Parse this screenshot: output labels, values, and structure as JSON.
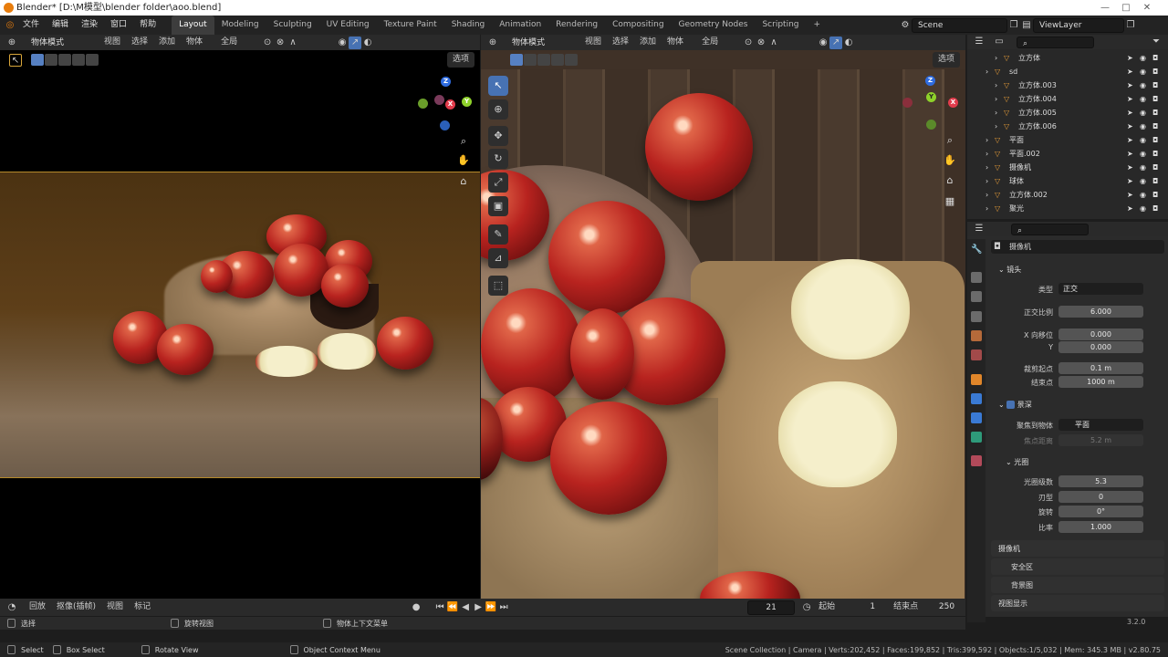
{
  "window": {
    "title": "Blender* [D:\\M模型\\blender folder\\aoo.blend]",
    "minimize": "—",
    "maximize": "□",
    "close": "✕"
  },
  "menu": [
    "文件",
    "编辑",
    "渲染",
    "窗口",
    "帮助"
  ],
  "workspaces": [
    "Layout",
    "Modeling",
    "Sculpting",
    "UV Editing",
    "Texture Paint",
    "Shading",
    "Animation",
    "Rendering",
    "Compositing",
    "Geometry Nodes",
    "Scripting"
  ],
  "active_workspace": "Layout",
  "add_tab": "+",
  "scene": "Scene",
  "view_layer": "ViewLayer",
  "viewport_left": {
    "mode": "物体模式",
    "menus": [
      "视图",
      "选择",
      "添加",
      "物体"
    ],
    "transform": "全局",
    "options": "选项"
  },
  "viewport_right": {
    "mode": "物体模式",
    "menus": [
      "视图",
      "选择",
      "添加",
      "物体"
    ],
    "transform": "全局",
    "options": "选项"
  },
  "gizmo_labels": {
    "x": "X",
    "y": "Y",
    "z": "Z"
  },
  "outliner": {
    "rows": [
      {
        "name": "立方体",
        "indent": 2
      },
      {
        "name": "sd",
        "indent": 1
      },
      {
        "name": "立方体.003",
        "indent": 2
      },
      {
        "name": "立方体.004",
        "indent": 2
      },
      {
        "name": "立方体.005",
        "indent": 2
      },
      {
        "name": "立方体.006",
        "indent": 2
      },
      {
        "name": "平面",
        "indent": 1
      },
      {
        "name": "平面.002",
        "indent": 1
      },
      {
        "name": "摄像机",
        "indent": 1
      },
      {
        "name": "球体",
        "indent": 1
      },
      {
        "name": "立方体.002",
        "indent": 1
      },
      {
        "name": "聚光",
        "indent": 1
      }
    ]
  },
  "properties": {
    "object_name": "摄像机",
    "lens_section": "镜头",
    "type_label": "类型",
    "type_value": "正交",
    "ortho_scale_label": "正交比例",
    "ortho_scale": "6.000",
    "shift_x_label": "X 向移位",
    "shift_x": "0.000",
    "shift_y_label": "Y",
    "shift_y": "0.000",
    "clip_start_label": "裁剪起点",
    "clip_start": "0.1 m",
    "clip_end_label": "结束点",
    "clip_end": "1000 m",
    "dof_section": "景深",
    "focus_object_label": "聚焦到物体",
    "focus_object": "平面",
    "focus_distance_label": "焦点距离",
    "focus_distance": "5.2 m",
    "aperture_section": "光圈",
    "fstop_label": "光圈级数",
    "fstop": "5.3",
    "blades_label": "刃型",
    "blades": "0",
    "rotation_label": "旋转",
    "rotation": "0°",
    "ratio_label": "比率",
    "ratio": "1.000",
    "collapsed": [
      "摄像机",
      "安全区",
      "背景图",
      "视图显示"
    ]
  },
  "timeline": {
    "playback": "回放",
    "keying": "抠像(插帧)",
    "view": "视图",
    "marker": "标记",
    "current_frame": "21",
    "start_label": "起始",
    "start": "1",
    "end_label": "结束点",
    "end": "250"
  },
  "status_hints": {
    "select": "选择",
    "rotate": "旋转视图",
    "context": "物体上下文菜单",
    "version_small": "3.2.0"
  },
  "statusbar": {
    "select": "Select",
    "box_select": "Box Select",
    "rotate": "Rotate View",
    "context": "Object Context Menu",
    "stats": "Scene Collection | Camera | Verts:202,452 | Faces:199,852 | Tris:399,592 | Objects:1/5,032 | Mem: 345.3 MB | v2.80.75"
  }
}
